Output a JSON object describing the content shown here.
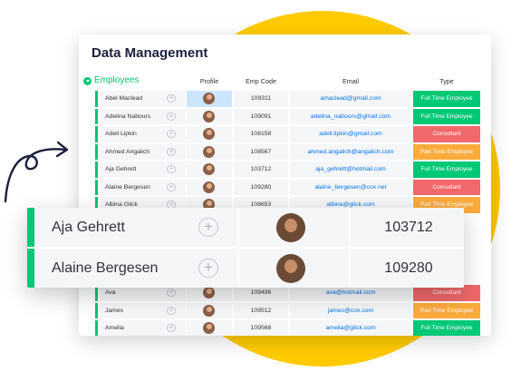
{
  "colors": {
    "group": "#00c875",
    "full_time": "#00c875",
    "part_time": "#fdab3d",
    "consultant": "#e2445c",
    "link": "#0073ea"
  },
  "board": {
    "title": "Data Management",
    "group": "Employees",
    "columns": {
      "profile": "Profile",
      "emp_code": "Emp Code",
      "email": "Email",
      "type": "Type"
    }
  },
  "rows": [
    {
      "name": "Abel Maclead",
      "code": "109311",
      "email": "amaclead@gmail.com",
      "type": "Full Time Employee",
      "type_color": "#00c875",
      "selected": true
    },
    {
      "name": "Adelina Nabours",
      "code": "109091",
      "email": "adelina_nabours@gmail.com",
      "type": "Full Time Employee",
      "type_color": "#00c875"
    },
    {
      "name": "Adell Lipkin",
      "code": "108158",
      "email": "adell.lipkin@gmail.com",
      "type": "Consultant",
      "type_color": "#f0686a"
    },
    {
      "name": "Ahmed Angalich",
      "code": "108567",
      "email": "ahmed.angalich@angalich.com",
      "type": "Part Time Employee",
      "type_color": "#fdab3d"
    },
    {
      "name": "Aja Gehrett",
      "code": "103712",
      "email": "aja_gehrett@hotmail.com",
      "type": "Full Time Employee",
      "type_color": "#00c875"
    },
    {
      "name": "Alaine Bergesen",
      "code": "109280",
      "email": "alaine_bergesen@cox.net",
      "type": "Consultant",
      "type_color": "#f0686a"
    },
    {
      "name": "Albina Glick",
      "code": "108653",
      "email": "albina@glick.com",
      "type": "Part Time Employee",
      "type_color": "#fdab3d"
    },
    {
      "name": "Ava",
      "code": "109496",
      "email": "ava@hotmail.com",
      "type": "Consultant",
      "type_color": "#f0686a"
    },
    {
      "name": "James",
      "code": "109512",
      "email": "james@cox.com",
      "type": "Part Time Employee",
      "type_color": "#fdab3d"
    },
    {
      "name": "Amelia",
      "code": "109568",
      "email": "amelia@glick.com",
      "type": "Full Time Employee",
      "type_color": "#00c875"
    }
  ],
  "zoom_rows": [
    {
      "name": "Aja Gehrett",
      "code": "103712"
    },
    {
      "name": "Alaine Bergesen",
      "code": "109280"
    }
  ],
  "icons": {
    "add": "add-update-icon",
    "arrow": "curly-arrow-icon"
  }
}
